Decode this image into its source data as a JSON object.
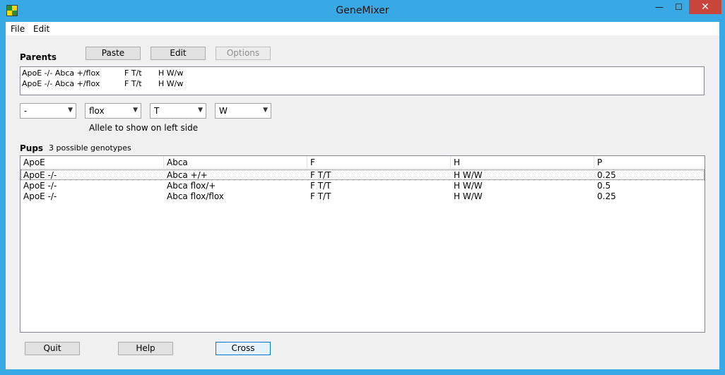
{
  "window": {
    "title": "GeneMixer",
    "controls": {
      "minimize": "—",
      "maximize": "☐",
      "close": "✕"
    }
  },
  "menu": [
    "File",
    "Edit"
  ],
  "parents": {
    "label": "Parents",
    "buttons": {
      "paste": "Paste",
      "edit": "Edit",
      "options": "Options"
    },
    "rows": [
      {
        "genotype": "ApoE -/- Abca +/flox",
        "f": "F T/t",
        "h": "H W/w"
      },
      {
        "genotype": "ApoE -/- Abca +/flox",
        "f": "F T/t",
        "h": "H W/w"
      }
    ]
  },
  "allele_selectors": {
    "values": [
      "-",
      "flox",
      "T",
      "W"
    ],
    "caption": "Allele to show on left side"
  },
  "pups": {
    "label": "Pups",
    "count_text": "3 possible genotypes",
    "columns": [
      "ApoE",
      "Abca",
      "F",
      "H",
      "P"
    ],
    "rows": [
      [
        "ApoE -/-",
        "Abca +/+",
        "F T/T",
        "H W/W",
        "0.25"
      ],
      [
        "ApoE -/-",
        "Abca flox/+",
        "F T/T",
        "H W/W",
        "0.5"
      ],
      [
        "ApoE -/-",
        "Abca flox/flox",
        "F T/T",
        "H W/W",
        "0.25"
      ]
    ],
    "selected_row": 0
  },
  "footer": {
    "quit": "Quit",
    "help": "Help",
    "cross": "Cross"
  },
  "colors": {
    "titlebar": "#39a9e5",
    "close_button": "#c7453a",
    "dialog_bg": "#f0f0f0",
    "focus_border": "#0078d7"
  }
}
